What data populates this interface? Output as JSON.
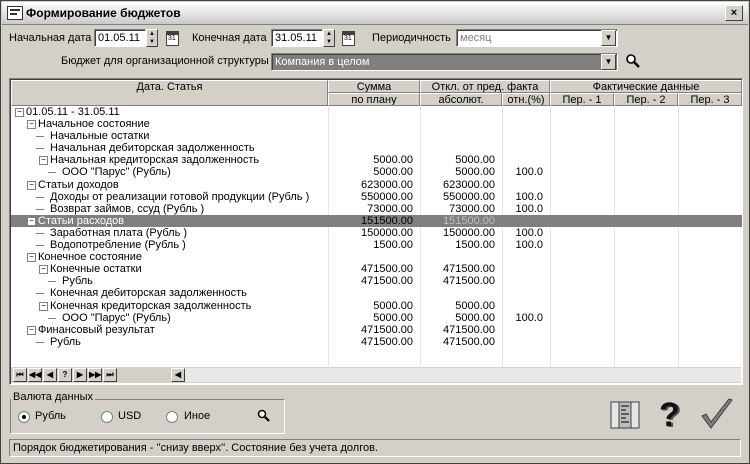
{
  "window": {
    "title": "Формирование бюджетов",
    "close_glyph": "×"
  },
  "params": {
    "start_label": "Начальная дата",
    "start_value": "01.05.11",
    "end_label": "Конечная дата",
    "end_value": "31.05.11",
    "period_label": "Периодичность",
    "period_value": "месяц",
    "budget_label": "Бюджет для организационной структуры",
    "budget_value": "Компания в целом"
  },
  "table": {
    "headers": {
      "col1": "Дата. Статья",
      "sum_top": "Сумма",
      "sum_bottom": "по плану",
      "dev_top": "Откл. от пред. факта",
      "dev_abs": "абсолют.",
      "dev_rel": "отн.(%)",
      "fact_top": "Фактические данные",
      "per1": "Пер. - 1",
      "per2": "Пер. - 2",
      "per3": "Пер. - 3"
    },
    "rows": [
      {
        "name": "01.05.11 - 31.05.11",
        "level": 0,
        "ex": "−",
        "plan": "",
        "abs": "",
        "rel": ""
      },
      {
        "name": "Начальное состояние",
        "level": 1,
        "ex": "−",
        "plan": "",
        "abs": "",
        "rel": ""
      },
      {
        "name": "Начальные остатки",
        "level": 2,
        "ex": "",
        "plan": "",
        "abs": "",
        "rel": ""
      },
      {
        "name": "Начальная дебиторская задолженность",
        "level": 2,
        "ex": "",
        "plan": "",
        "abs": "",
        "rel": ""
      },
      {
        "name": "Начальная кредиторская задолженность",
        "level": 2,
        "ex": "−",
        "plan": "5000.00",
        "abs": "5000.00",
        "rel": ""
      },
      {
        "name": "ООО \"Парус\" (Рубль)",
        "level": 3,
        "ex": "",
        "plan": "5000.00",
        "abs": "5000.00",
        "rel": "100.0"
      },
      {
        "name": "Статьи доходов",
        "level": 1,
        "ex": "−",
        "plan": "623000.00",
        "abs": "623000.00",
        "rel": ""
      },
      {
        "name": "Доходы от реализации готовой продукции (Рубль )",
        "level": 2,
        "ex": "",
        "plan": "550000.00",
        "abs": "550000.00",
        "rel": "100.0"
      },
      {
        "name": "Возврат займов, ссуд (Рубль )",
        "level": 2,
        "ex": "",
        "plan": "73000.00",
        "abs": "73000.00",
        "rel": "100.0"
      },
      {
        "name": "Статьи расходов",
        "level": 1,
        "ex": "−",
        "plan": "151500.00",
        "abs": "151500.00",
        "rel": "",
        "selected": true
      },
      {
        "name": "Заработная плата (Рубль )",
        "level": 2,
        "ex": "",
        "plan": "150000.00",
        "abs": "150000.00",
        "rel": "100.0"
      },
      {
        "name": "Водопотребление (Рубль )",
        "level": 2,
        "ex": "",
        "plan": "1500.00",
        "abs": "1500.00",
        "rel": "100.0"
      },
      {
        "name": "Конечное состояние",
        "level": 1,
        "ex": "−",
        "plan": "",
        "abs": "",
        "rel": ""
      },
      {
        "name": "Конечные остатки",
        "level": 2,
        "ex": "−",
        "plan": "471500.00",
        "abs": "471500.00",
        "rel": ""
      },
      {
        "name": "Рубль",
        "level": 3,
        "ex": "",
        "plan": "471500.00",
        "abs": "471500.00",
        "rel": ""
      },
      {
        "name": "Конечная дебиторская задолженность",
        "level": 2,
        "ex": "",
        "plan": "",
        "abs": "",
        "rel": ""
      },
      {
        "name": "Конечная кредиторская задолженность",
        "level": 2,
        "ex": "−",
        "plan": "5000.00",
        "abs": "5000.00",
        "rel": ""
      },
      {
        "name": "ООО \"Парус\" (Рубль)",
        "level": 3,
        "ex": "",
        "plan": "5000.00",
        "abs": "5000.00",
        "rel": "100.0"
      },
      {
        "name": "Финансовый результат",
        "level": 1,
        "ex": "−",
        "plan": "471500.00",
        "abs": "471500.00",
        "rel": ""
      },
      {
        "name": "Рубль",
        "level": 2,
        "ex": "",
        "plan": "471500.00",
        "abs": "471500.00",
        "rel": ""
      }
    ]
  },
  "nav": {
    "first": "⏮",
    "prev_page": "◀◀",
    "prev": "◀",
    "help": "?",
    "next": "▶",
    "next_page": "▶▶",
    "last": "⏭",
    "scroll_left": "◀"
  },
  "currency": {
    "group_label": "Валюта данных",
    "options": [
      "Рубль",
      "USD",
      "Иное"
    ],
    "selected": "Рубль"
  },
  "status": "Порядок бюджетирования - ''снизу вверх''. Состояние без учета долгов.",
  "icons": {
    "search": "magnifier-icon",
    "ruler": "ruler-icon",
    "help": "question-icon",
    "ok": "checkmark-icon"
  },
  "colors": {
    "selection": "#7f7f7f",
    "accent_check": "#7f7f7f"
  }
}
